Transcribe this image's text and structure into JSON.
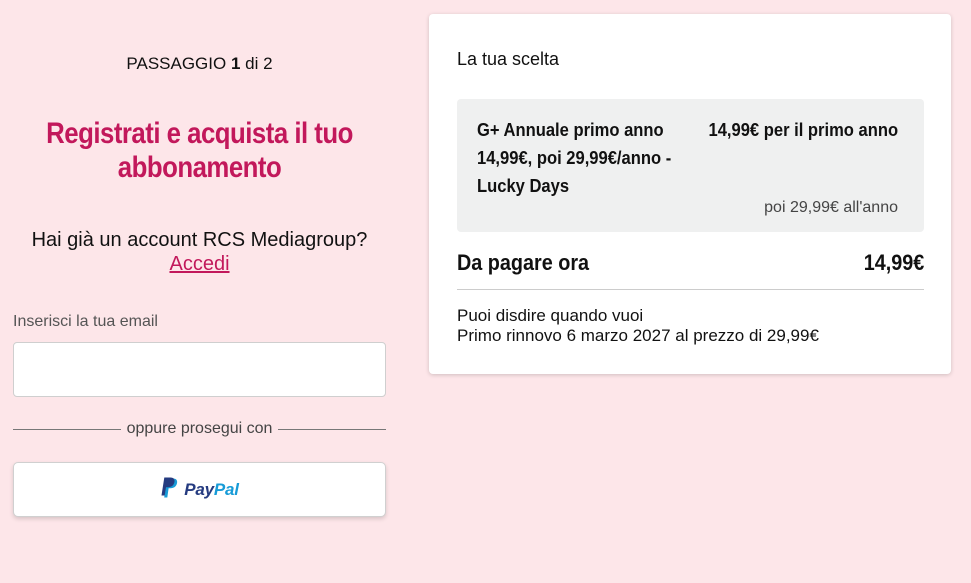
{
  "signup": {
    "step_prefix": "PASSAGGIO",
    "step_current": "1",
    "step_suffix": "di 2",
    "headline": "Registrati e acquista il tuo abbonamento",
    "have_account": "Hai già un account RCS Mediagroup?",
    "login_link": "Accedi",
    "email_label": "Inserisci la tua email",
    "email_value": "",
    "email_placeholder": "",
    "divider_text": "oppure prosegui con",
    "paypal_label_part1": "Pay",
    "paypal_label_part2": "Pal"
  },
  "summary": {
    "title": "La tua scelta",
    "plan_name": "G+ Annuale primo anno 14,99€, poi 29,99€/anno - Lucky Days",
    "plan_price": "14,99€ per il primo anno",
    "plan_then": "poi 29,99€ all'anno",
    "due_label": "Da pagare ora",
    "due_amount": "14,99€",
    "cancel_note": "Puoi disdire quando vuoi",
    "renewal_note": "Primo rinnovo 6 marzo 2027 al prezzo di 29,99€"
  },
  "colors": {
    "background": "#fde6e9",
    "accent": "#c2185b",
    "paypal_dark": "#253b80",
    "paypal_light": "#179bd7"
  },
  "icons": {
    "paypal": "paypal-logo-icon"
  }
}
